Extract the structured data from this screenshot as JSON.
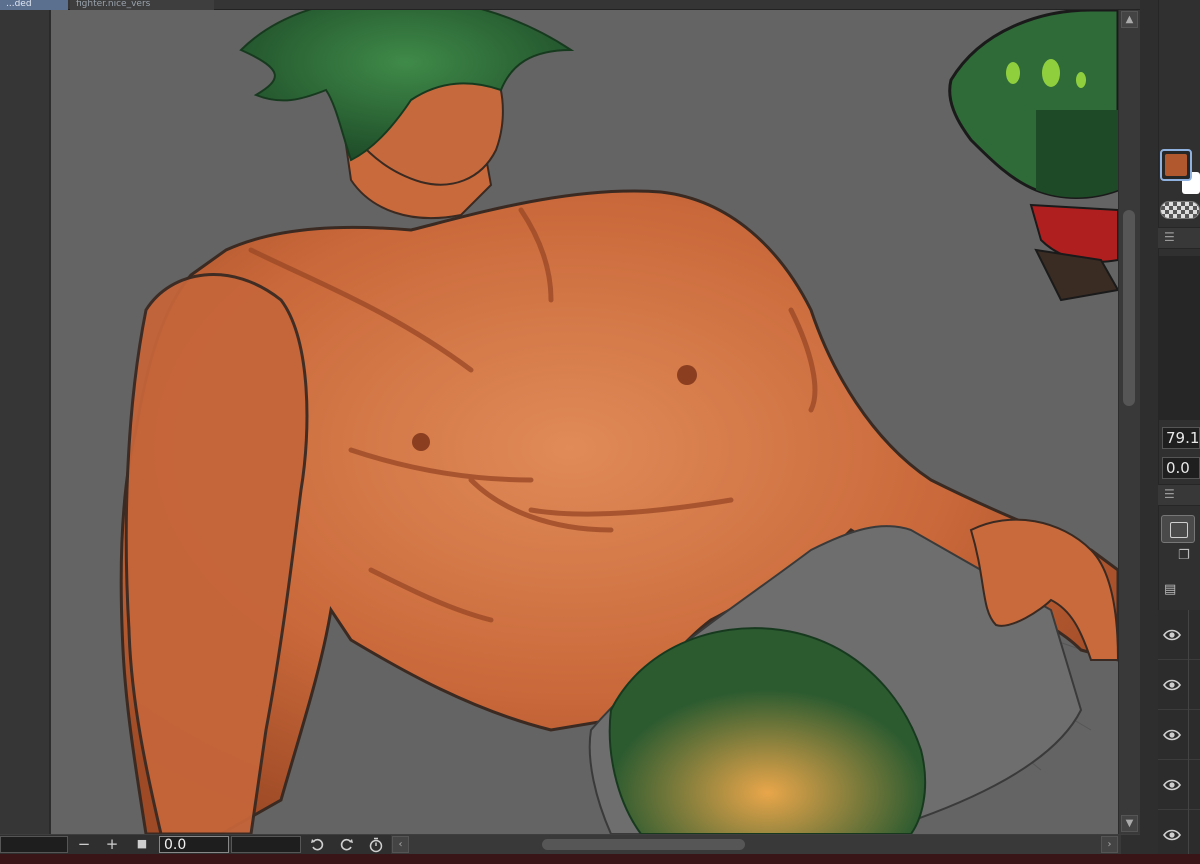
{
  "tabs": [
    {
      "label": "...ded",
      "active": true
    },
    {
      "label": "fighter.nice_vers",
      "active": false
    }
  ],
  "canvas": {
    "background_color": "#646464",
    "artwork": "digital painting in progress"
  },
  "color_panel": {
    "main_color": "#b2582e",
    "sub_color": "#ffffff"
  },
  "properties": {
    "value_1": "79.1",
    "value_2": "0.0"
  },
  "bottom_toolbar": {
    "zoom_out_label": "−",
    "zoom_in_label": "+",
    "fit_label": "■",
    "rotation_value": "0.0",
    "undo_icon": "rotate-left-icon",
    "redo_icon": "rotate-right-icon",
    "reset_icon": "reset-rotation-icon"
  },
  "layers": [
    {
      "visible": true
    },
    {
      "visible": true
    },
    {
      "visible": true
    },
    {
      "visible": true
    },
    {
      "visible": true
    }
  ],
  "scrollbars": {
    "up_arrow": "▲",
    "down_arrow": "▼",
    "left_arrow": "‹",
    "right_arrow": "›"
  }
}
